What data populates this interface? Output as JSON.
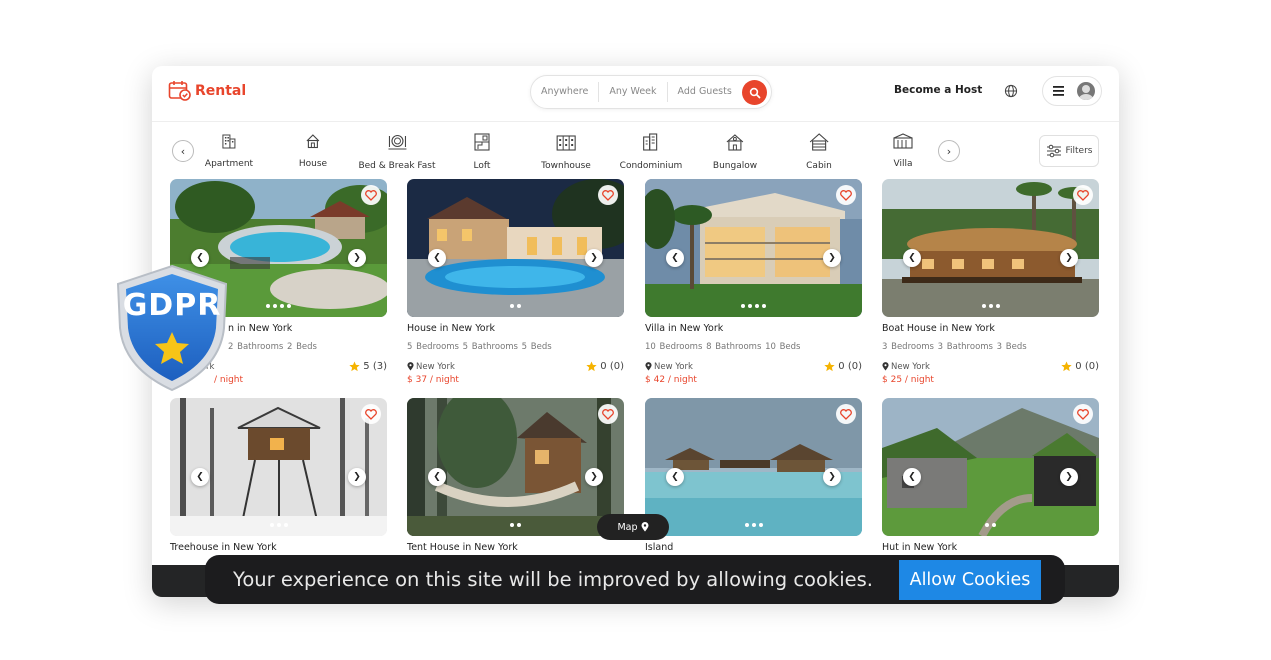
{
  "header": {
    "logo_text": "Rental",
    "search": {
      "anywhere": "Anywhere",
      "any_week": "Any Week",
      "add_guests": "Add Guests"
    },
    "become_host": "Become a Host"
  },
  "categories": [
    {
      "label": "Apartment",
      "icon": "apartment-icon"
    },
    {
      "label": "House",
      "icon": "house-icon"
    },
    {
      "label": "Bed & Break Fast",
      "icon": "bed-breakfast-icon"
    },
    {
      "label": "Loft",
      "icon": "loft-icon"
    },
    {
      "label": "Townhouse",
      "icon": "townhouse-icon"
    },
    {
      "label": "Condominium",
      "icon": "condominium-icon"
    },
    {
      "label": "Bungalow",
      "icon": "bungalow-icon"
    },
    {
      "label": "Cabin",
      "icon": "cabin-icon"
    },
    {
      "label": "Villa",
      "icon": "villa-icon"
    }
  ],
  "filters_label": "Filters",
  "listings": [
    {
      "title": "n in New York",
      "specs": "2 Bathrooms  2 Beds",
      "location": "rk",
      "rating": "5 (3)",
      "price": "/ night"
    },
    {
      "title": "House in New York",
      "specs": "5 Bedrooms  5 Bathrooms  5 Beds",
      "location": "New York",
      "rating": "0 (0)",
      "price": "$ 37 / night"
    },
    {
      "title": "Villa in New York",
      "specs": "10 Bedrooms  8 Bathrooms  10 Beds",
      "location": "New York",
      "rating": "0 (0)",
      "price": "$ 42 / night"
    },
    {
      "title": "Boat House in New York",
      "specs": "3 Bedrooms  3 Bathrooms  3 Beds",
      "location": "New York",
      "rating": "0 (0)",
      "price": "$ 25 / night"
    },
    {
      "title": "Treehouse in New York"
    },
    {
      "title": "Tent House in New York"
    },
    {
      "title": "Island"
    },
    {
      "title": "Hut in New York"
    }
  ],
  "map_label": "Map",
  "gdpr_label": "GDPR",
  "cookie": {
    "message": "Your experience on this site will be improved by allowing cookies.",
    "button": "Allow Cookies"
  },
  "colors": {
    "accent": "#e8452c",
    "cookie_button": "#1e88e5",
    "banner_bg": "#1c1c1e",
    "star": "#f5b301"
  }
}
